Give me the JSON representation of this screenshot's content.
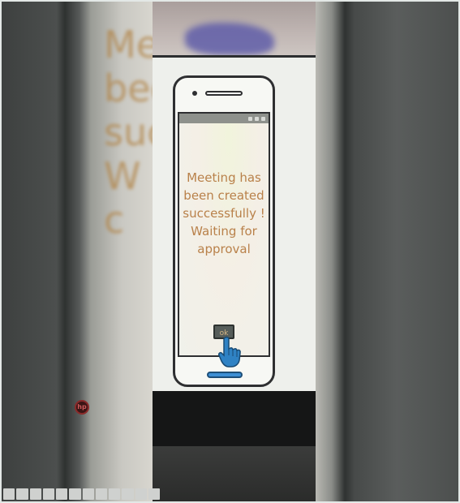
{
  "background_blur": {
    "ghost_text": "Me\nbee\nsuc\nW\nc"
  },
  "dialog": {
    "message": "Meeting has been created successfully ! Waiting for approval",
    "ok_label": "ok"
  },
  "colors": {
    "message_text": "#b9814a",
    "ok_button_bg": "#565d5a",
    "hand_cursor": "#2f82c4",
    "home_button": "#3e8fd4"
  },
  "icons": {
    "pointer": "hand-pointer-icon",
    "laptop_logo": "hp-logo-icon"
  }
}
